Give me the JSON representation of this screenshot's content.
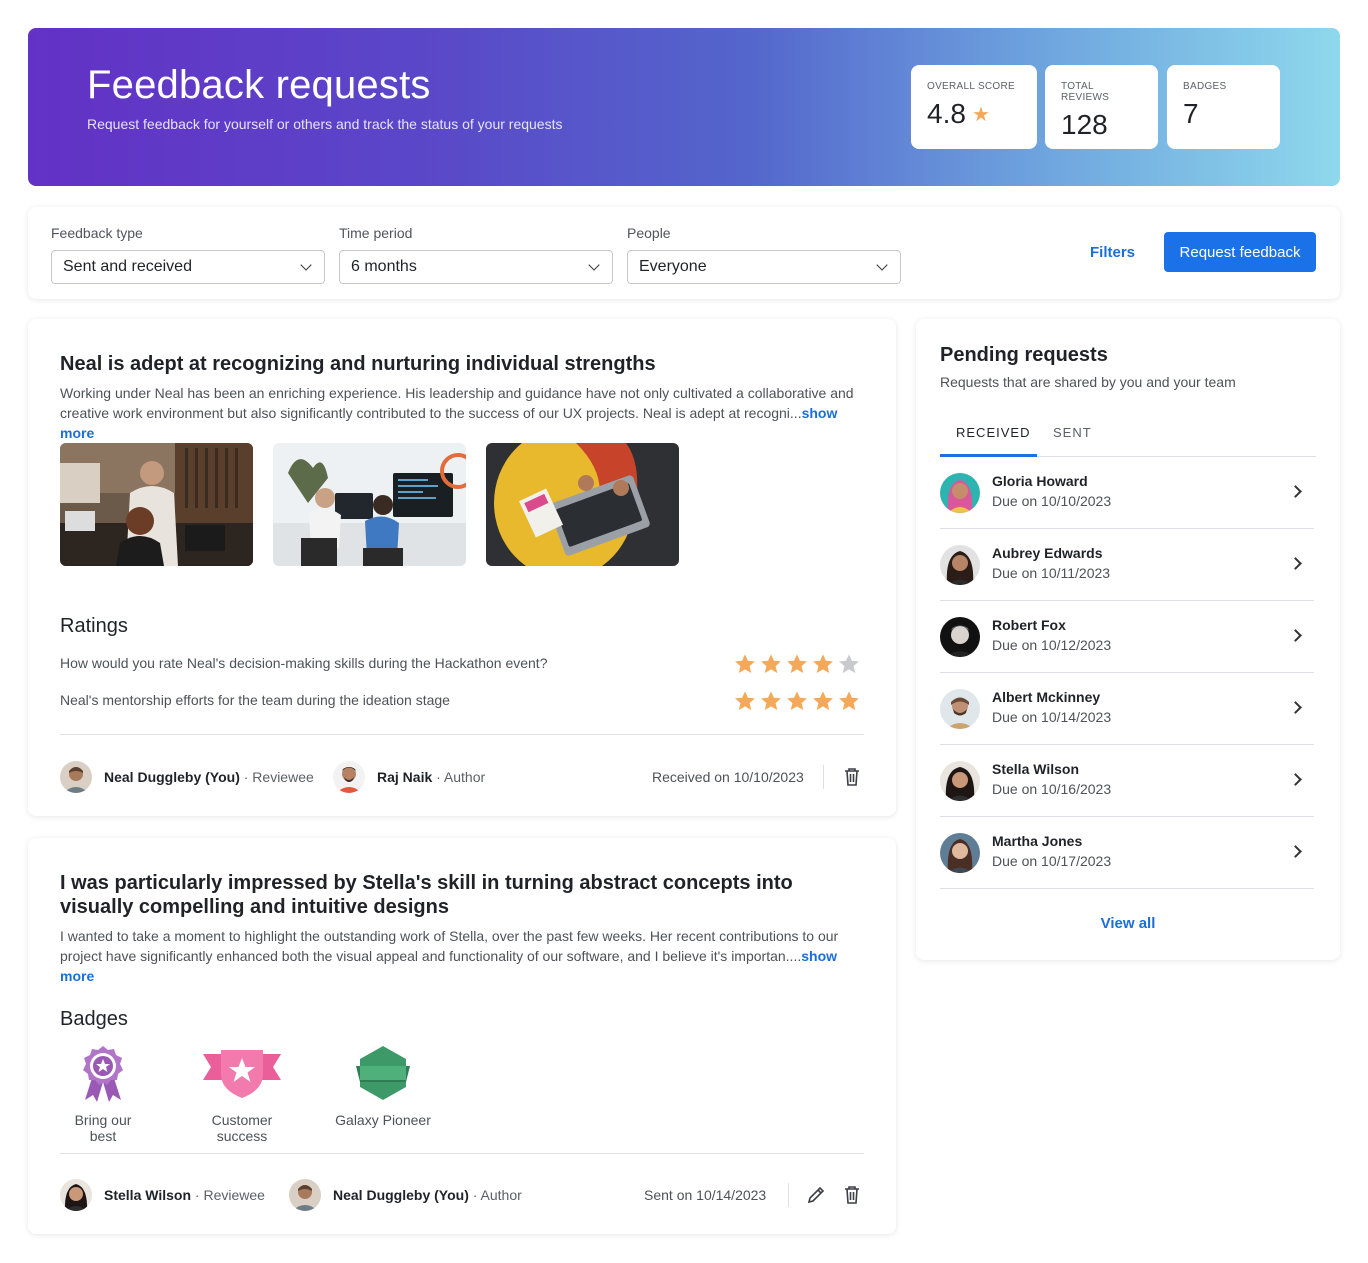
{
  "header": {
    "title": "Feedback requests",
    "subtitle": "Request feedback for yourself or others and track the status of your requests",
    "stats": [
      {
        "label": "OVERALL SCORE",
        "value": "4.8",
        "icon": "star-icon"
      },
      {
        "label": "TOTAL REVIEWS",
        "value": "128"
      },
      {
        "label": "BADGES",
        "value": "7"
      }
    ]
  },
  "filters": {
    "feedback_type": {
      "label": "Feedback type",
      "value": "Sent and received"
    },
    "time_period": {
      "label": "Time period",
      "value": "6 months"
    },
    "people": {
      "label": "People",
      "value": "Everyone"
    },
    "filters_link": "Filters",
    "request_button": "Request feedback"
  },
  "feedback": [
    {
      "title": "Neal is adept at recognizing and nurturing individual strengths",
      "body": "Working under Neal has been an enriching experience. His leadership and guidance have not only cultivated a collaborative and creative work environment but also significantly contributed to the success of our UX projects. Neal is adept at recogni...",
      "show_more": "show more",
      "ratings_title": "Ratings",
      "ratings": [
        {
          "question": "How would you rate Neal's decision-making skills during the Hackathon event?",
          "stars": 4,
          "max": 5
        },
        {
          "question": "Neal's mentorship efforts for the team during the ideation stage",
          "stars": 5,
          "max": 5
        }
      ],
      "reviewee": {
        "name": "Neal Duggleby (You)",
        "role": "· Reviewee"
      },
      "author": {
        "name": "Raj Naik",
        "role": "· Author"
      },
      "date": "Received on 10/10/2023"
    },
    {
      "title": "I was particularly impressed by Stella's skill in turning abstract concepts into visually compelling and intuitive designs",
      "body": "I wanted to take a moment to highlight the outstanding work of Stella, over the past few weeks. Her recent contributions to our project have significantly enhanced both the visual appeal and functionality of our software, and I believe it's importan....",
      "show_more": "show more",
      "badges_title": "Badges",
      "badges": [
        {
          "label": "Bring our best",
          "icon": "award-medal-icon",
          "color": "#9a59b5"
        },
        {
          "label": "Customer success",
          "icon": "star-shield-icon",
          "color": "#ea5f9a"
        },
        {
          "label": "Galaxy Pioneer",
          "icon": "hexagon-banner-icon",
          "color": "#3d9a68"
        }
      ],
      "reviewee": {
        "name": "Stella Wilson",
        "role": "· Reviewee"
      },
      "author": {
        "name": "Neal Duggleby (You)",
        "role": "· Author"
      },
      "date": "Sent on 10/14/2023"
    }
  ],
  "pending": {
    "title": "Pending requests",
    "subtitle": "Requests that are shared by you and your team",
    "tabs": [
      "RECEIVED",
      "SENT"
    ],
    "items": [
      {
        "name": "Gloria Howard",
        "due": "Due on 10/10/2023"
      },
      {
        "name": "Aubrey Edwards",
        "due": "Due on 10/11/2023"
      },
      {
        "name": "Robert Fox",
        "due": "Due on 10/12/2023"
      },
      {
        "name": "Albert Mckinney",
        "due": "Due on 10/14/2023"
      },
      {
        "name": "Stella Wilson",
        "due": "Due on 10/16/2023"
      },
      {
        "name": "Martha Jones",
        "due": "Due on 10/17/2023"
      }
    ],
    "view_all": "View all"
  },
  "colors": {
    "accent": "#1b72e8",
    "star": "#f3a85a",
    "star_empty": "#c8cacd"
  }
}
